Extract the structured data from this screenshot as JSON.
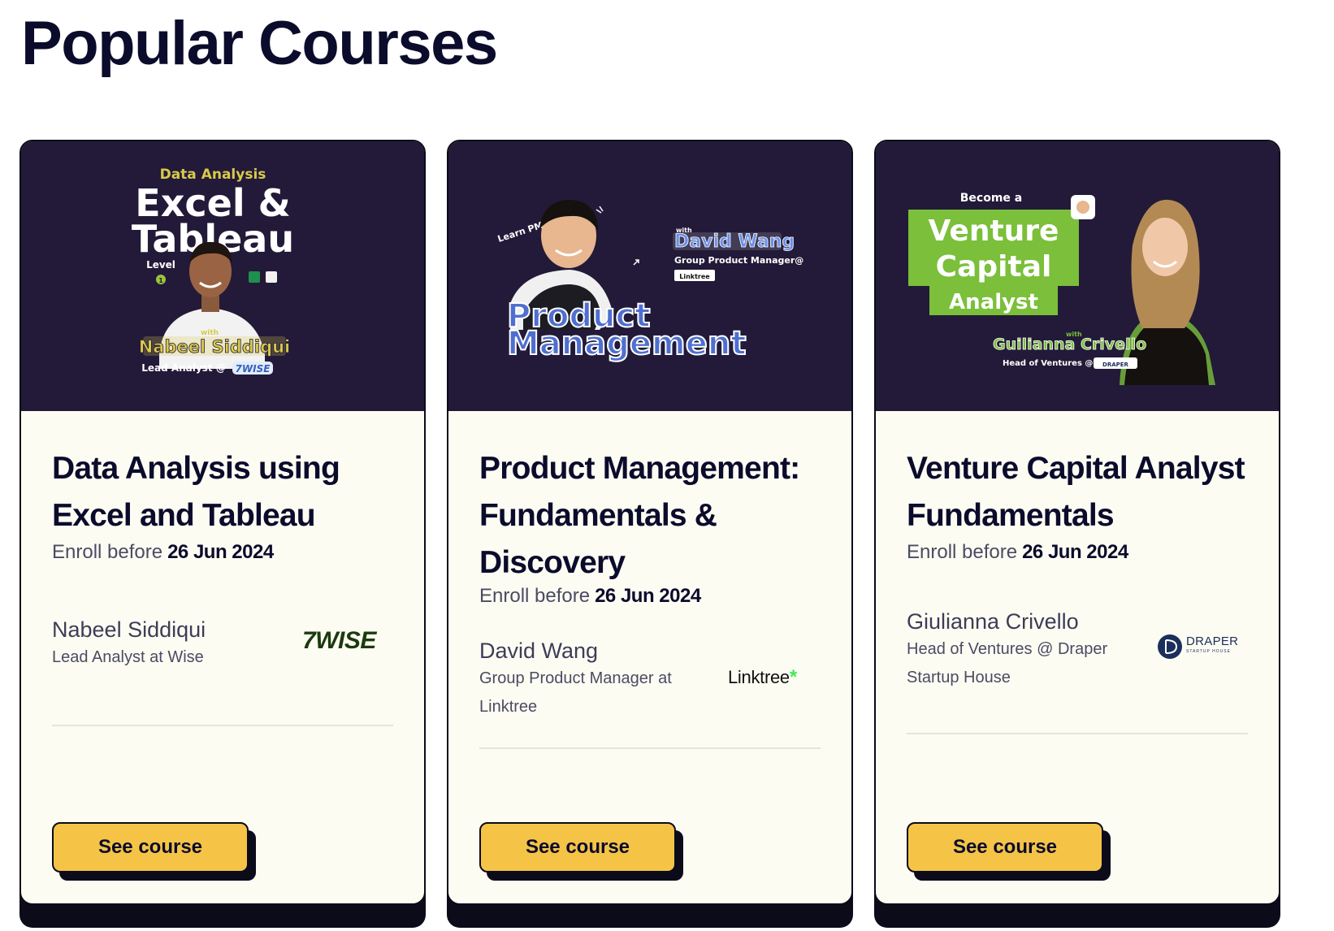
{
  "page": {
    "title": "Popular Courses"
  },
  "courses": [
    {
      "banner": {
        "kicker": "Data Analysis",
        "headline_line1": "Excel &",
        "headline_line2": "Tableau",
        "level_label": "Level",
        "level_value": "1",
        "with_label": "with",
        "host_name": "Nabeel Siddiqui",
        "host_role": "Lead Analyst @",
        "host_company": "7WISE"
      },
      "title": "Data Analysis using Excel and Tableau",
      "enroll_label": "Enroll before",
      "enroll_date": "26 Jun 2024",
      "instructor_name": "Nabeel Siddiqui",
      "instructor_role": "Lead Analyst at Wise",
      "company_logo_text": "7WISE",
      "button_label": "See course"
    },
    {
      "banner": {
        "scribble": "Learn PM",
        "with_label": "with",
        "host_name": "David Wang",
        "host_role": "Group Product Manager@",
        "host_company": "Linktree",
        "headline_line1": "Product",
        "headline_line2": "Management"
      },
      "title": "Product Management: Fundamentals & Discovery",
      "enroll_label": "Enroll before",
      "enroll_date": "26 Jun 2024",
      "instructor_name": "David Wang",
      "instructor_role": "Group Product Manager at Linktree",
      "company_logo_text": "Linktree",
      "company_logo_mark": "*",
      "button_label": "See course"
    },
    {
      "banner": {
        "kicker": "Become a",
        "headline_line1": "Venture",
        "headline_line2": "Capital",
        "headline_line3": "Analyst",
        "with_label": "with",
        "host_name": "Guilianna Crivello",
        "host_role": "Head of Ventures @",
        "host_company": "DRAPER"
      },
      "title": "Venture Capital Analyst Fundamentals",
      "enroll_label": "Enroll before",
      "enroll_date": "26 Jun 2024",
      "instructor_name": "Giulianna Crivello",
      "instructor_role": "Head of Ventures @ Draper Startup House",
      "company_logo_text": "DRAPER",
      "company_logo_subtext": "STARTUP HOUSE",
      "button_label": "See course"
    }
  ],
  "colors": {
    "banner_bg": "#221a38",
    "card_bg": "#fdfcf3",
    "button_bg": "#f5c446",
    "ink": "#0b0b2c",
    "accent_green": "#7bbf3a",
    "accent_blue": "#4f7be0",
    "wise_green": "#1b3a0e",
    "linktree_green": "#43e660",
    "draper_navy": "#1b2f5c"
  }
}
